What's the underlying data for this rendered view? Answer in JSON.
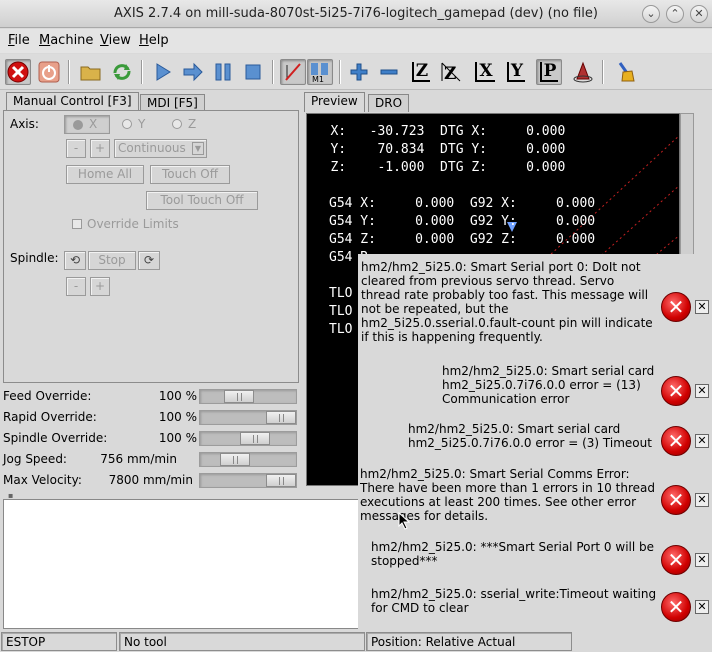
{
  "window": {
    "title": "AXIS 2.7.4 on mill-suda-8070st-5i25-7i76-logitech_gamepad (dev) (no file)"
  },
  "menu": [
    {
      "pre": "",
      "ul": "F",
      "post": "ile"
    },
    {
      "pre": "",
      "ul": "M",
      "post": "achine"
    },
    {
      "pre": "",
      "ul": "V",
      "post": "iew"
    },
    {
      "pre": "",
      "ul": "H",
      "post": "elp"
    }
  ],
  "toolbar": {
    "z": "Z",
    "x": "X",
    "y": "Y",
    "p": "P"
  },
  "tabs": {
    "manual": "Manual Control [F3]",
    "mdi": "MDI [F5]",
    "preview": "Preview",
    "dro": "DRO"
  },
  "manual": {
    "axis_label": "Axis:",
    "axis_x": "X",
    "axis_y": "Y",
    "axis_z": "Z",
    "minus": "-",
    "plus": "+",
    "increment": "Continuous",
    "home_all": "Home All",
    "touch_off": "Touch Off",
    "tool_touch_off": "Tool Touch Off",
    "override_limits": "Override Limits",
    "spindle_label": "Spindle:",
    "spindle_stop": "Stop"
  },
  "sliders": [
    {
      "label": "Feed Override:",
      "value": "100 %",
      "fraction": 0.36
    },
    {
      "label": "Rapid Override:",
      "value": "100 %",
      "fraction": 1.0
    },
    {
      "label": "Spindle Override:",
      "value": "100 %",
      "fraction": 0.6
    },
    {
      "label": "Jog Speed:",
      "value": "756 mm/min",
      "fraction": 0.3
    },
    {
      "label": "Max Velocity:",
      "value": "7800 mm/min",
      "fraction": 1.0
    }
  ],
  "dro": {
    "lines": [
      "   X:   -30.723  DTG X:     0.000",
      "   Y:    70.834  DTG Y:     0.000",
      "   Z:    -1.000  DTG Z:     0.000",
      "",
      "G54 X:     0.000  G92 X:     0.000",
      "G54 Y:     0.000  G92 Y:     0.000",
      "G54 Z:     0.000  G92 Z:     0.000",
      "G54 R:",
      "",
      "TLO",
      "TLO",
      "TLO"
    ]
  },
  "errors": [
    "hm2/hm2_5i25.0: Smart Serial port 0: DoIt not cleared from previous servo thread. Servo thread rate probably too fast. This message will not be repeated, but the hm2_5i25.0.sserial.0.fault-count pin will indicate if this is happening frequently.",
    "hm2/hm2_5i25.0: Smart serial card hm2_5i25.0.7i76.0.0 error = (13) Communication error",
    "hm2/hm2_5i25.0: Smart serial card hm2_5i25.0.7i76.0.0 error = (3) Timeout",
    "hm2/hm2_5i25.0: Smart Serial Comms Error: There have been more than 1 errors in 10 thread executions at least 200 times. See other error messages for details.",
    "hm2/hm2_5i25.0: ***Smart Serial Port 0 will be stopped***",
    "hm2/hm2_5i25.0: sserial_write:Timeout waiting for CMD to clear"
  ],
  "error_icon_glyph": "✕",
  "error_close_glyph": "✕",
  "status": {
    "state": "ESTOP",
    "tool": "No tool",
    "position": "Position: Relative Actual"
  },
  "colors": {
    "dro_bg": "#000000",
    "dro_text": "#ffffff",
    "error_red": "#d00000"
  }
}
